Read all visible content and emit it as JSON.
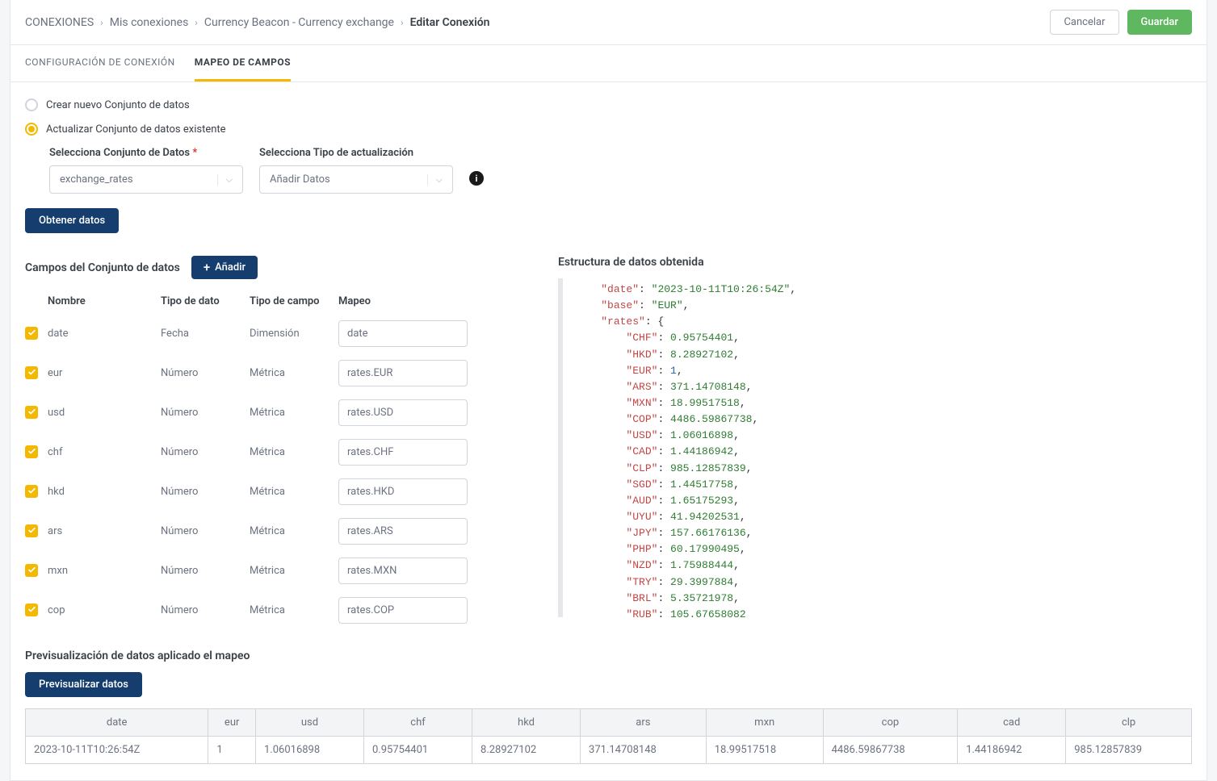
{
  "breadcrumb": {
    "root": "CONEXIONES",
    "level1": "Mis conexiones",
    "level2": "Currency Beacon - Currency exchange",
    "current": "Editar Conexión"
  },
  "buttons": {
    "cancel": "Cancelar",
    "save": "Guardar",
    "getData": "Obtener datos",
    "add": "Añadir",
    "preview": "Previsualizar datos"
  },
  "tabs": {
    "config": "CONFIGURACIÓN DE CONEXIÓN",
    "mapping": "MAPEO DE CAMPOS"
  },
  "radios": {
    "create": "Crear nuevo Conjunto de datos",
    "update": "Actualizar Conjunto de datos existente"
  },
  "form": {
    "selectDataset": "Selecciona Conjunto de Datos",
    "selectUpdateType": "Selecciona Tipo de actualización",
    "dataset": "exchange_rates",
    "updateType": "Añadir Datos"
  },
  "sections": {
    "fields": "Campos del Conjunto de datos",
    "structure": "Estructura de datos obtenida",
    "preview": "Previsualización de datos aplicado el mapeo"
  },
  "fieldsHeader": {
    "name": "Nombre",
    "dataType": "Tipo de dato",
    "fieldType": "Tipo de campo",
    "mapping": "Mapeo"
  },
  "fields": [
    {
      "name": "date",
      "dataType": "Fecha",
      "fieldType": "Dimensión",
      "mapping": "date"
    },
    {
      "name": "eur",
      "dataType": "Número",
      "fieldType": "Métrica",
      "mapping": "rates.EUR"
    },
    {
      "name": "usd",
      "dataType": "Número",
      "fieldType": "Métrica",
      "mapping": "rates.USD"
    },
    {
      "name": "chf",
      "dataType": "Número",
      "fieldType": "Métrica",
      "mapping": "rates.CHF"
    },
    {
      "name": "hkd",
      "dataType": "Número",
      "fieldType": "Métrica",
      "mapping": "rates.HKD"
    },
    {
      "name": "ars",
      "dataType": "Número",
      "fieldType": "Métrica",
      "mapping": "rates.ARS"
    },
    {
      "name": "mxn",
      "dataType": "Número",
      "fieldType": "Métrica",
      "mapping": "rates.MXN"
    },
    {
      "name": "cop",
      "dataType": "Número",
      "fieldType": "Métrica",
      "mapping": "rates.COP"
    }
  ],
  "json": {
    "date": "2023-10-11T10:26:54Z",
    "base": "EUR",
    "rates": [
      {
        "k": "CHF",
        "v": "0.95754401"
      },
      {
        "k": "HKD",
        "v": "8.28927102"
      },
      {
        "k": "EUR",
        "v": "1",
        "lit": true
      },
      {
        "k": "ARS",
        "v": "371.14708148"
      },
      {
        "k": "MXN",
        "v": "18.99517518"
      },
      {
        "k": "COP",
        "v": "4486.59867738"
      },
      {
        "k": "USD",
        "v": "1.06016898"
      },
      {
        "k": "CAD",
        "v": "1.44186942"
      },
      {
        "k": "CLP",
        "v": "985.12857839"
      },
      {
        "k": "SGD",
        "v": "1.44517758"
      },
      {
        "k": "AUD",
        "v": "1.65175293"
      },
      {
        "k": "UYU",
        "v": "41.94202531"
      },
      {
        "k": "JPY",
        "v": "157.66176136"
      },
      {
        "k": "PHP",
        "v": "60.17990495"
      },
      {
        "k": "NZD",
        "v": "1.75988444"
      },
      {
        "k": "TRY",
        "v": "29.3997884"
      },
      {
        "k": "BRL",
        "v": "5.35721978"
      },
      {
        "k": "RUB",
        "v": "105.67658082"
      }
    ]
  },
  "preview": {
    "headers": [
      "date",
      "eur",
      "usd",
      "chf",
      "hkd",
      "ars",
      "mxn",
      "cop",
      "cad",
      "clp"
    ],
    "row": [
      "2023-10-11T10:26:54Z",
      "1",
      "1.06016898",
      "0.95754401",
      "8.28927102",
      "371.14708148",
      "18.99517518",
      "4486.59867738",
      "1.44186942",
      "985.12857839"
    ]
  }
}
